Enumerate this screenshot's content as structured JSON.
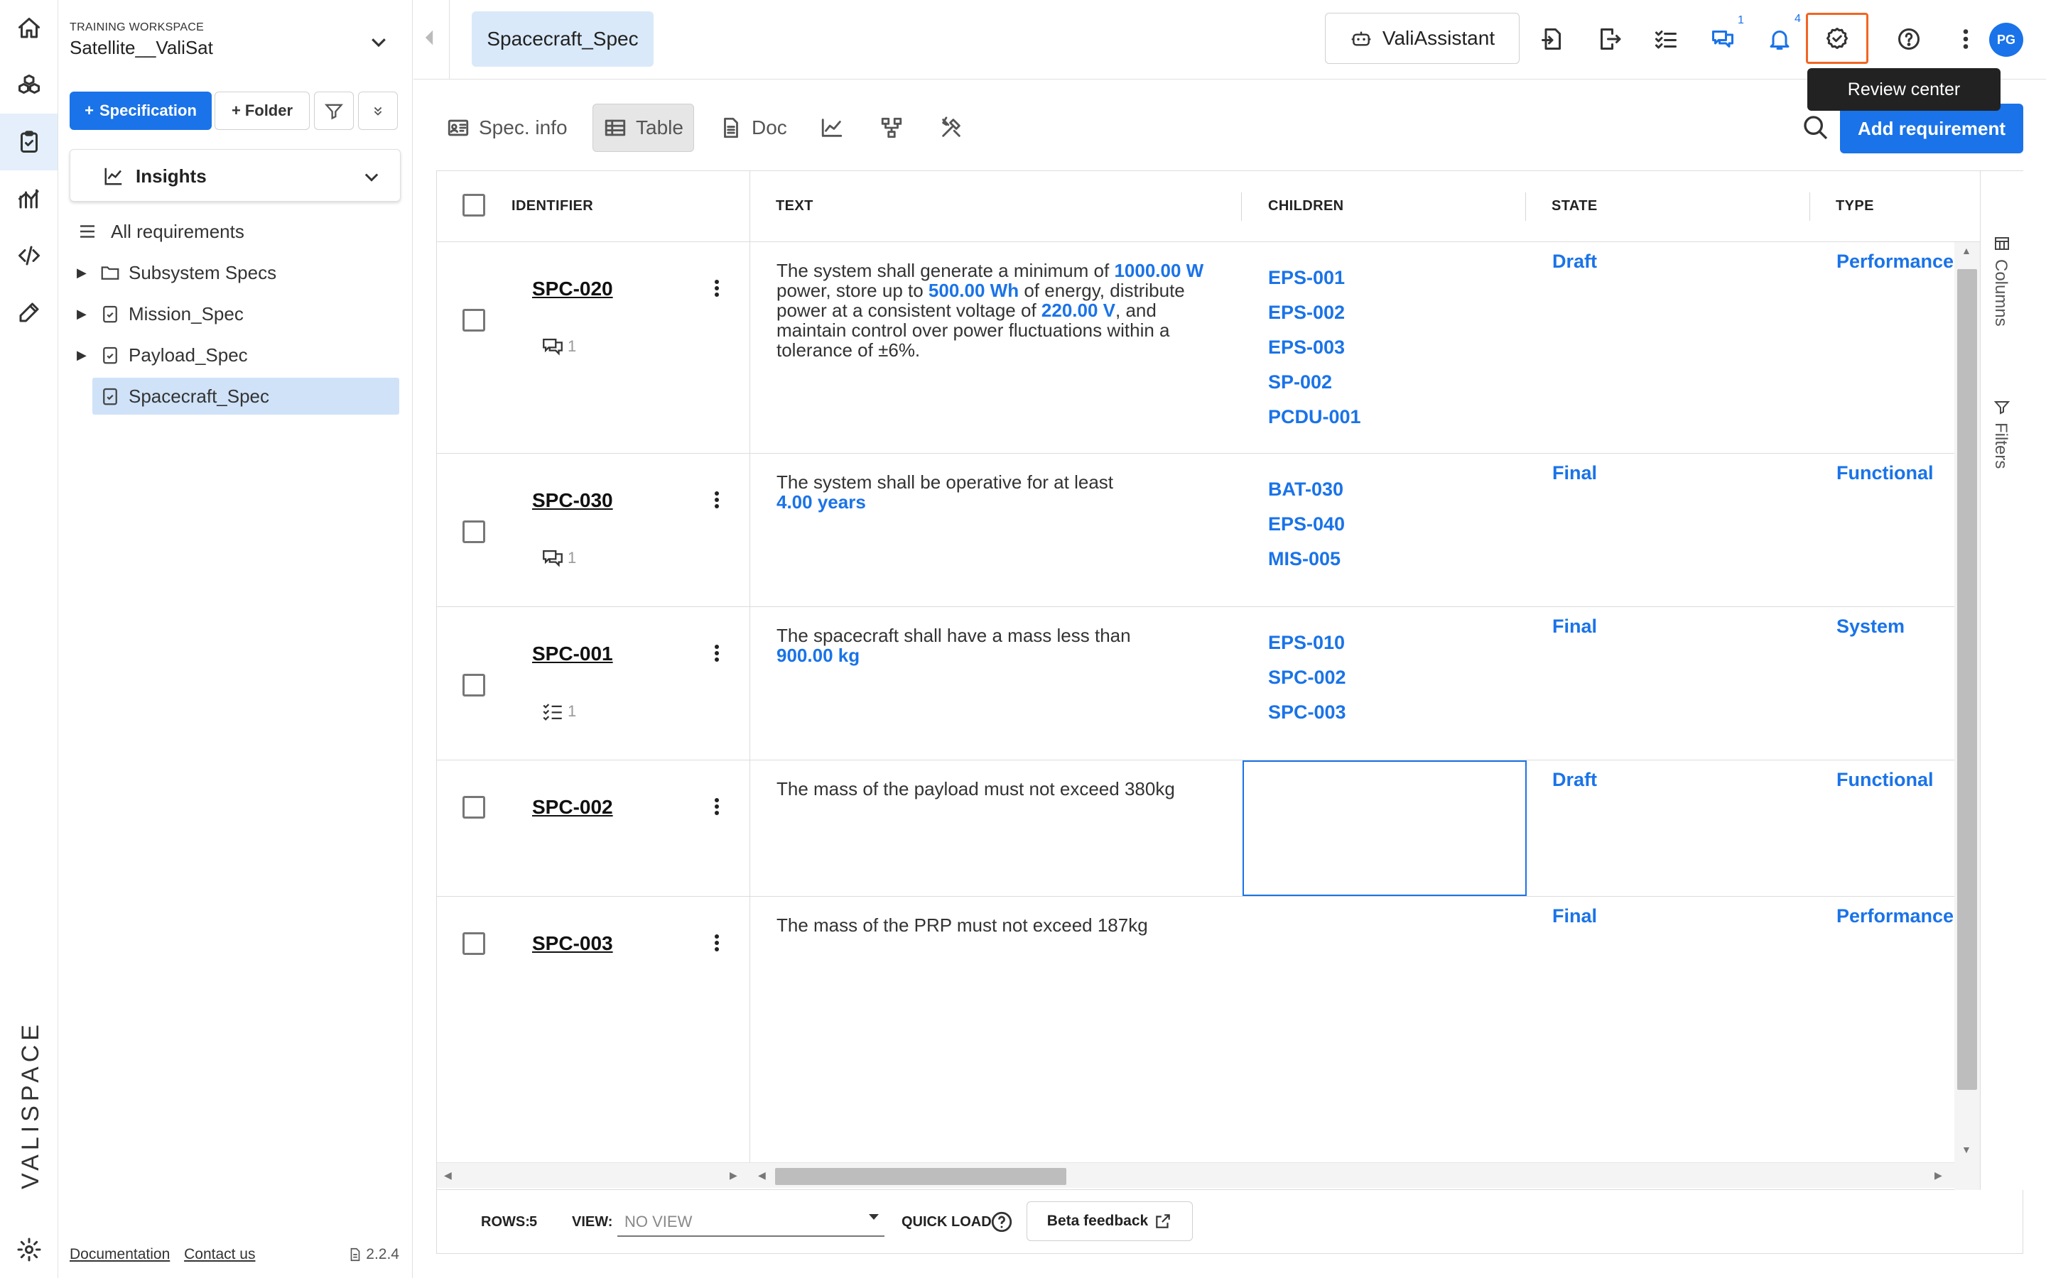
{
  "workspace": {
    "label": "TRAINING WORKSPACE",
    "name": "Satellite__ValiSat"
  },
  "sidebar": {
    "buttons": {
      "specification": "Specification",
      "folder": "Folder"
    },
    "insights_label": "Insights",
    "tree": [
      {
        "label": "All requirements",
        "icon": "list-icon"
      },
      {
        "label": "Subsystem Specs",
        "icon": "folder-icon"
      },
      {
        "label": "Mission_Spec",
        "icon": "clipboard-icon"
      },
      {
        "label": "Payload_Spec",
        "icon": "clipboard-icon"
      },
      {
        "label": "Spacecraft_Spec",
        "icon": "clipboard-icon",
        "selected": true
      }
    ],
    "footer": {
      "documentation": "Documentation",
      "contact": "Contact us",
      "version": "2.2.4"
    }
  },
  "brand": "VALISPACE",
  "topbar": {
    "tab": "Spacecraft_Spec",
    "assistant": "ValiAssistant",
    "comments_badge": "1",
    "notifications_badge": "4",
    "avatar": "PG",
    "tooltip": "Review center"
  },
  "toolbar": {
    "spec_info": "Spec. info",
    "table": "Table",
    "doc": "Doc",
    "add_requirement": "Add requirement"
  },
  "table": {
    "headers": {
      "identifier": "IDENTIFIER",
      "text": "TEXT",
      "children": "CHILDREN",
      "state": "STATE",
      "type": "TYPE"
    },
    "rows": [
      {
        "id": "SPC-020",
        "badge_count": "1",
        "text_parts": [
          "The system shall generate a minimum of",
          "1000.00  W",
          "power, store up to",
          "500.00  Wh",
          "of energy, distribute power at a consistent voltage of",
          "220.00  V",
          ", and maintain control over power fluctuations within a tolerance of ±6%."
        ],
        "children": [
          "EPS-001",
          "EPS-002",
          "EPS-003",
          "SP-002",
          "PCDU-001"
        ],
        "state": "Draft",
        "type": "Performance"
      },
      {
        "id": "SPC-030",
        "badge_count": "1",
        "text_parts": [
          "The system shall be operative for at least",
          "4.00  years"
        ],
        "children": [
          "BAT-030",
          "EPS-040",
          "MIS-005"
        ],
        "state": "Final",
        "type": "Functional"
      },
      {
        "id": "SPC-001",
        "badge_count": "1",
        "text_parts": [
          "The spacecraft shall have a mass less than",
          "900.00  kg"
        ],
        "children": [
          "EPS-010",
          "SPC-002",
          "SPC-003"
        ],
        "state": "Final",
        "type": "System"
      },
      {
        "id": "SPC-002",
        "text": "The mass of the payload must not exceed 380kg",
        "children": [],
        "state": "Draft",
        "type": "Functional"
      },
      {
        "id": "SPC-003",
        "text": "The mass of the PRP must not exceed 187kg",
        "children": [],
        "state": "Final",
        "type": "Performance"
      }
    ],
    "side_columns": "Columns",
    "side_filters": "Filters"
  },
  "footer": {
    "rows_label": "ROWS:",
    "rows_value": "5",
    "view_label": "VIEW:",
    "view_placeholder": "NO VIEW",
    "quick_load": "QUICK LOAD",
    "beta_feedback": "Beta feedback"
  },
  "colors": {
    "accent": "#1a73e8",
    "highlight": "#f26522"
  }
}
